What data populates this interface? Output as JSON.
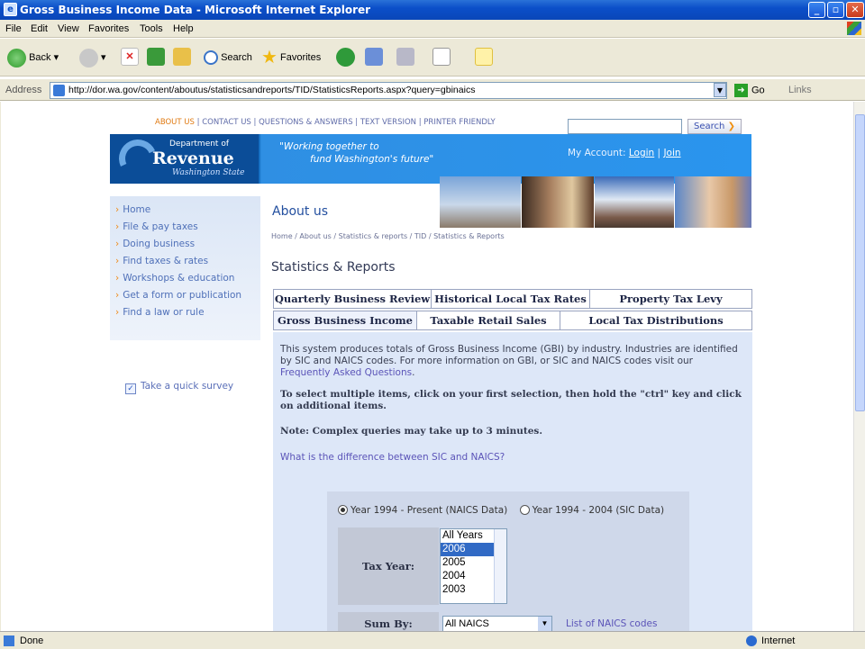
{
  "window": {
    "title": "Gross Business Income Data - Microsoft Internet Explorer"
  },
  "menu": [
    "File",
    "Edit",
    "View",
    "Favorites",
    "Tools",
    "Help"
  ],
  "toolbar": {
    "back": "Back",
    "search": "Search",
    "favorites": "Favorites"
  },
  "address": {
    "label": "Address",
    "url": "http://dor.wa.gov/content/aboutus/statisticsandreports/TID/StatisticsReports.aspx?query=gbinaics",
    "go": "Go",
    "links": "Links"
  },
  "status": {
    "text": "Done",
    "zone": "Internet"
  },
  "page": {
    "top_links": {
      "about": "ABOUT US",
      "rest": "| CONTACT US | QUESTIONS & ANSWERS | TEXT VERSION | PRINTER FRIENDLY"
    },
    "search_button": "Search",
    "logo": {
      "dept": "Department of",
      "name": "Revenue",
      "state": "Washington State"
    },
    "slogan": {
      "line1": "\"Working together to",
      "line2": "fund Washington's future\""
    },
    "account": {
      "label": "My Account:",
      "login": "Login",
      "join": "Join"
    },
    "nav": [
      "Home",
      "File & pay taxes",
      "Doing business",
      "Find taxes & rates",
      "Workshops & education",
      "Get a form or publication",
      "Find a law or rule"
    ],
    "survey": "Take a quick survey",
    "section": "About us",
    "breadcrumb": "Home / About us / Statistics & reports / TID / Statistics & Reports",
    "title": "Statistics & Reports",
    "tabs_row1": [
      "Quarterly Business Review",
      "Historical Local Tax Rates",
      "Property Tax Levy"
    ],
    "tabs_row2": [
      "Gross Business Income",
      "Taxable Retail Sales",
      "Local Tax Distributions"
    ],
    "intro": "This system produces totals of Gross Business Income (GBI) by industry. Industries are identified by SIC and NAICS codes. For more information on GBI, or SIC and NAICS codes visit our",
    "faq_link": "Frequently Asked Questions",
    "multi_select_note": "To select multiple items, click on your first selection, then hold the \"ctrl\" key and click on additional items.",
    "complex_note": "Note: Complex queries may take up to 3 minutes.",
    "diff_link": "What is the difference between SIC and NAICS?",
    "radio_naics": "Year 1994 - Present (NAICS Data)",
    "radio_sic": "Year 1994 - 2004 (SIC Data)",
    "tax_year_label": "Tax Year:",
    "tax_years": [
      "All Years",
      "2006",
      "2005",
      "2004",
      "2003"
    ],
    "sum_by_label": "Sum By:",
    "sum_by_value": "All NAICS",
    "naics_link": "List of NAICS codes"
  }
}
